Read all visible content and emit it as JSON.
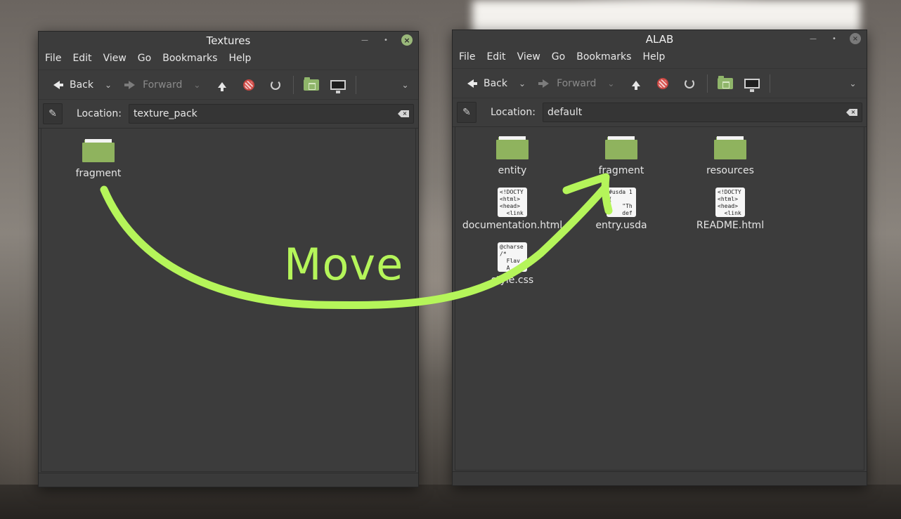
{
  "menu": [
    "File",
    "Edit",
    "View",
    "Go",
    "Bookmarks",
    "Help"
  ],
  "toolbar": {
    "back": "Back",
    "forward": "Forward"
  },
  "location_label": "Location:",
  "left_window": {
    "title": "Textures",
    "location": "texture_pack",
    "items": [
      {
        "name": "fragment",
        "type": "folder"
      }
    ]
  },
  "right_window": {
    "title": "ALAB",
    "location": "default",
    "items": [
      {
        "name": "entity",
        "type": "folder"
      },
      {
        "name": "fragment",
        "type": "folder"
      },
      {
        "name": "resources",
        "type": "folder"
      },
      {
        "name": "documentation.html",
        "type": "file",
        "preview": "<!DOCTY\n<html>\n<head>\n  <link"
      },
      {
        "name": "entry.usda",
        "type": "file",
        "preview": "#usda 1\n(\n    \"Th\n    def"
      },
      {
        "name": "README.html",
        "type": "file",
        "preview": "<!DOCTY\n<html>\n<head>\n  <link"
      },
      {
        "name": "style.css",
        "type": "file",
        "preview": "@charse\n/*\n  Flav\n  A"
      }
    ]
  },
  "annotation": {
    "text": "Move",
    "color": "#b5f55a"
  },
  "colors": {
    "folder": "#8fb35e",
    "window_bg": "#3c3c3c",
    "accent_close": "#9ab87a"
  }
}
